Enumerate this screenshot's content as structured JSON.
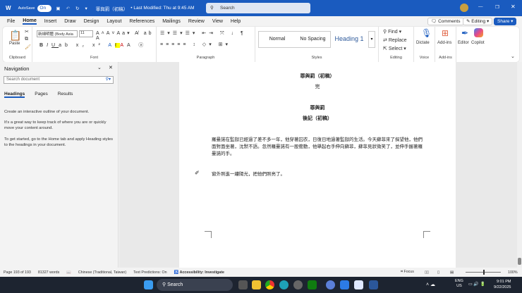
{
  "titlebar": {
    "autosave_label": "AutoSave",
    "autosave_state": "On",
    "doc_title": "罪與罰（初稿）",
    "last_modified": "• Last Modified: Thu at 9:45 AM",
    "search_placeholder": "Search"
  },
  "menu": [
    "File",
    "Home",
    "Insert",
    "Draw",
    "Design",
    "Layout",
    "References",
    "Mailings",
    "Review",
    "View",
    "Help"
  ],
  "right_buttons": {
    "comments": "Comments",
    "editing": "Editing",
    "share": "Share"
  },
  "ribbon": {
    "clipboard": {
      "paste": "Paste",
      "label": "Clipboard"
    },
    "font": {
      "font_name": "新細明體 (Body Asia",
      "font_size": "11",
      "label": "Font"
    },
    "paragraph": {
      "label": "Paragraph"
    },
    "styles": {
      "items": [
        "Normal",
        "No Spacing",
        "Heading 1"
      ],
      "label": "Styles"
    },
    "editing": {
      "find": "Find",
      "replace": "Replace",
      "select": "Select",
      "label": "Editing"
    },
    "voice": {
      "dictate": "Dictate",
      "label": "Voice"
    },
    "addins": {
      "button": "Add-ins",
      "label": "Add-ins"
    },
    "editor": "Editor",
    "copilot": "Copilot"
  },
  "navigation": {
    "title": "Navigation",
    "search_placeholder": "Search document",
    "tabs": [
      "Headings",
      "Pages",
      "Results"
    ],
    "text1": "Create an interactive outline of your document.",
    "text2": "It's a great way to keep track of where you are or quickly move your content around.",
    "text3": "To get started, go to the Home tab and apply Heading styles to the headings in your document."
  },
  "document": {
    "title1": "罪與罰（初稿）",
    "end": "完",
    "title2": "罪與罰",
    "title3": "後記（初稿）",
    "paragraph1": "羅曼諾在監獄已經過了差不多一年，他穿著囚衣，日復日地過著監獄的生活。今天蘇菲來了探望他，他們面對面坐著，沈默不語。忽然羅曼諾有一股衝動，他舉起右手伸向蘇菲，蘇菲見狀微笑了，並伸手握著羅曼諾的手。",
    "paragraph2": "窗外照進一縷陽光，把他們照亮了。"
  },
  "status": {
    "page": "Page 193 of 193",
    "words": "81327 words",
    "language": "Chinese (Traditional, Taiwan)",
    "predictions": "Text Predictions: On",
    "accessibility": "Accessibility: Investigate",
    "focus": "Focus",
    "zoom": "100%",
    "zoom_level": 100
  },
  "taskbar": {
    "search": "Search",
    "lang1": "ENG",
    "lang2": "US",
    "time": "9:01 PM",
    "date": "9/22/2025"
  },
  "colors": {
    "accent": "#1a5bbf"
  }
}
